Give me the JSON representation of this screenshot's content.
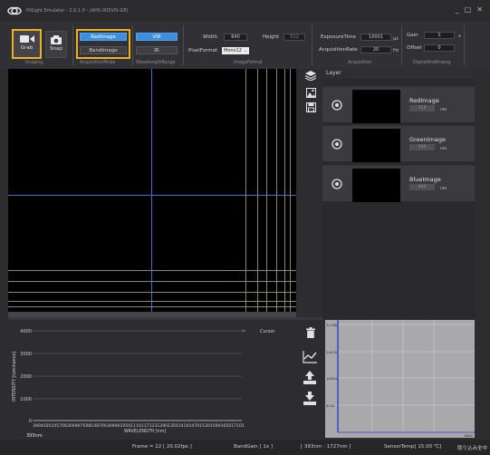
{
  "app": {
    "title": "HiSight Emulator - 2.0.1.0 - (AHS-003VIS-GE)"
  },
  "window_controls": {
    "minimize": "_",
    "maximize": "□",
    "close": "✕"
  },
  "toolbar": {
    "grab_label": "Grab",
    "snap_label": "Snap",
    "group_imaging": "Imaging",
    "red_image": "RedImage",
    "band_image": "BandImage",
    "group_acq_mode": "AcquisitionMode",
    "vir": "VIR",
    "ir": "IR",
    "group_wavelength": "WavelengthRange",
    "width_label": "Width",
    "width_value": "640",
    "height_label": "Height",
    "height_value": "512",
    "pixel_format_label": "PixelFormat",
    "pixel_format_value": "Mono12",
    "group_image_format": "ImageFormat",
    "exposure_label": "ExposureTime",
    "exposure_value": "10001",
    "exposure_unit": "μs",
    "rate_label": "AcquisitionRate",
    "rate_value": "20",
    "rate_unit": "Hz",
    "group_acquisition": "Acquisition",
    "gain_label": "Gain",
    "gain_value": "1",
    "gain_unit": "x",
    "offset_label": "Offset",
    "offset_value": "0",
    "group_digital": "DigitalAndAnalog"
  },
  "layers": {
    "title": "Layer",
    "items": [
      {
        "name": "RedImage",
        "wavelength": "715",
        "unit": "nm"
      },
      {
        "name": "GreenImage",
        "wavelength": "544",
        "unit": "nm"
      },
      {
        "name": "BlueImage",
        "wavelength": "444",
        "unit": "nm"
      }
    ]
  },
  "spectrum": {
    "legend": "Cursor",
    "y_ticks": [
      "4000",
      "3000",
      "2000",
      "1000",
      "0"
    ],
    "ylabel": "INTENSITY [luminance]",
    "x_ticks": "39045051057063069075081087093099010501110117123129013501410147015301590165017101",
    "xlabel": "WAVELENGTH [nm]",
    "cursor_readout": "393nm"
  },
  "histogram": {
    "y_ticks": [
      "32768",
      "24576",
      "16384",
      "8192"
    ],
    "x_max": "4095"
  },
  "status": {
    "frame": "Frame = 22 [ 20.02fps ]",
    "band_gain": "BandGain [ 1x ]",
    "range": "[ 393nm - 1727nm ]",
    "sensor_temp": "SensorTemp[ 15.00 ℃]",
    "capture": "取り込み全中"
  },
  "colors": {
    "accent_yellow": "#f0b21a",
    "selected_blue": "#3a8fe0",
    "cursor_blue": "#3a6fd8"
  }
}
